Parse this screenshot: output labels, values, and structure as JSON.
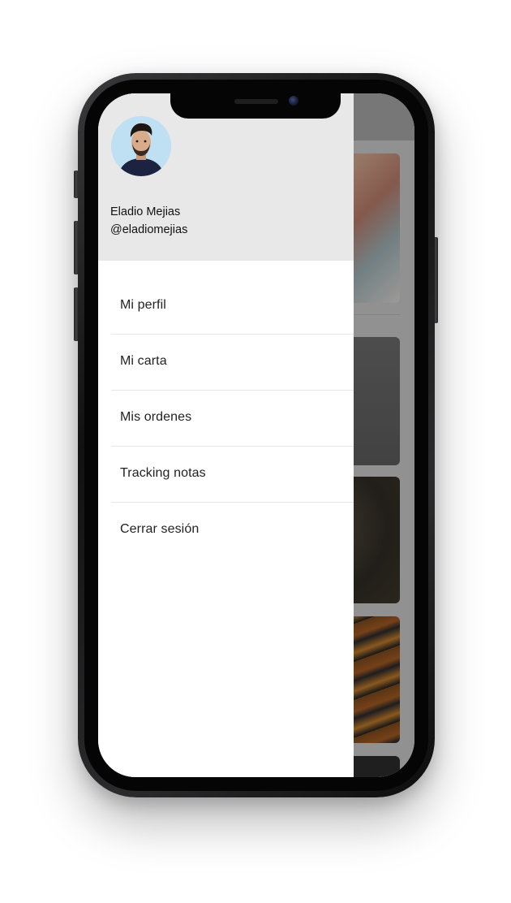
{
  "user": {
    "name": "Eladio Mejias",
    "handle": "@eladiomejias"
  },
  "menu": {
    "items": [
      {
        "label": "Mi perfil",
        "icon": "none"
      },
      {
        "label": "Mi carta",
        "icon": "none"
      },
      {
        "label": "Mis ordenes",
        "icon": "none"
      },
      {
        "label": "Tracking notas",
        "icon": "none"
      },
      {
        "label": "Cerrar sesión",
        "icon": "none"
      }
    ]
  },
  "colors": {
    "drawer_header_bg": "#e8e8e8",
    "drawer_bg": "#ffffff",
    "scrim": "rgba(0,0,0,0.28)",
    "text": "#111111",
    "avatar_bg": "#bfe0f2"
  }
}
